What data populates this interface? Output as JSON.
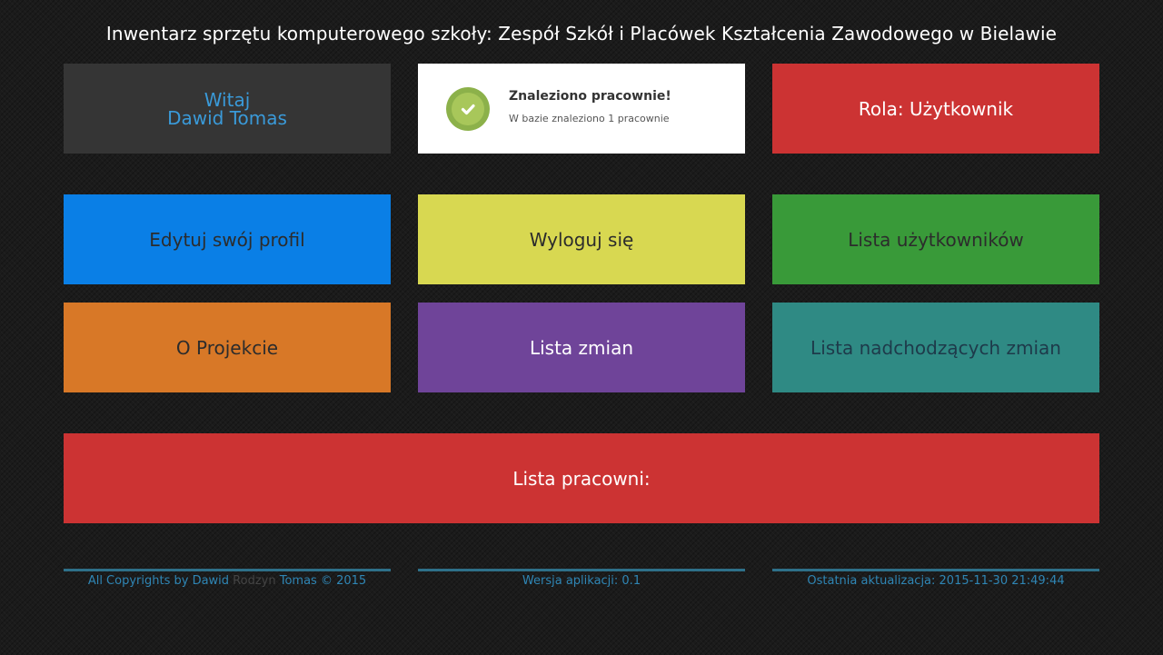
{
  "header": {
    "title": "Inwentarz sprzętu komputerowego szkoły: Zespół Szkół i Placówek Kształcenia Zawodowego w Bielawie"
  },
  "welcome": {
    "greeting": "Witaj",
    "user_name": "Dawid Tomas"
  },
  "notice": {
    "title": "Znaleziono pracownie!",
    "message": "W bazie znaleziono 1 pracownie",
    "icon": "check-circle-icon",
    "icon_color": "#8cc152"
  },
  "role": {
    "label": "Rola: Użytkownik"
  },
  "menu": {
    "edit_profile": "Edytuj swój profil",
    "logout": "Wyloguj się",
    "users_list": "Lista użytkowników",
    "about": "O Projekcie",
    "changelog": "Lista zmian",
    "upcoming_changes": "Lista nadchodzących zmian"
  },
  "labs": {
    "label": "Lista pracowni:"
  },
  "footer": {
    "copyright_prefix": "All Copyrights by Dawid ",
    "copyright_nick": "Rodzyn",
    "copyright_suffix": " Tomas © 2015",
    "version": "Wersja aplikacji: 0.1",
    "last_update": "Ostatnia aktualizacja: 2015-11-30 21:49:44"
  },
  "colors": {
    "background": "#1b1b1b",
    "tile_dark": "#353535",
    "tile_red": "#cc3333",
    "tile_blue": "#0a7fe6",
    "tile_yellow": "#d8d851",
    "tile_green": "#399a39",
    "tile_orange": "#d87827",
    "tile_purple": "#6f4499",
    "tile_teal": "#2f8a84",
    "footer_line": "#2e7089",
    "footer_text": "#2f86b5"
  }
}
